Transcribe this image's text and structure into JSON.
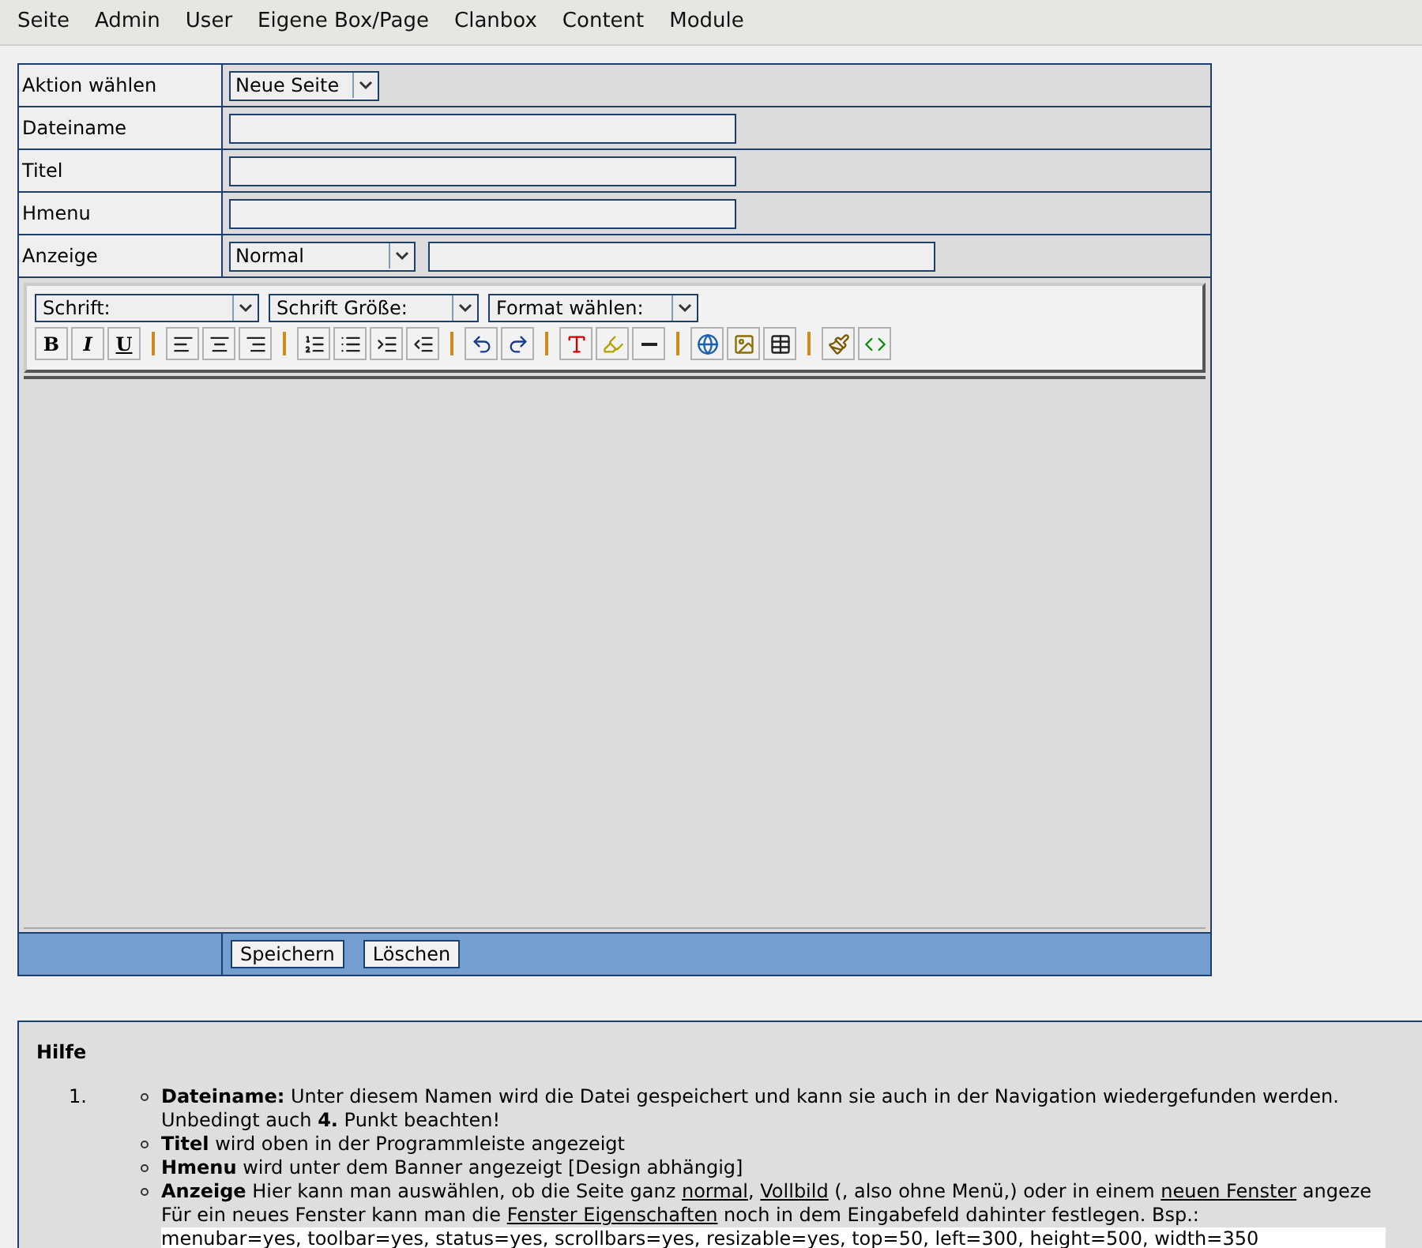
{
  "menu": [
    "Seite",
    "Admin",
    "User",
    "Eigene Box/Page",
    "Clanbox",
    "Content",
    "Module"
  ],
  "form": {
    "rows": [
      {
        "label": "Aktion wählen",
        "kind": "select",
        "value": "Neue Seite"
      },
      {
        "label": "Dateiname",
        "kind": "input"
      },
      {
        "label": "Titel",
        "kind": "input"
      },
      {
        "label": "Hmenu",
        "kind": "input"
      },
      {
        "label": "Anzeige",
        "kind": "select-input",
        "value": "Normal"
      }
    ],
    "editor": {
      "selects": [
        "Schrift:",
        "Schrift Größe:",
        "Format wählen:"
      ],
      "tools": [
        {
          "kind": "bold",
          "label": "B"
        },
        {
          "kind": "italic",
          "label": "I"
        },
        {
          "kind": "underline",
          "label": "U"
        },
        {
          "kind": "separator"
        },
        {
          "kind": "align-left"
        },
        {
          "kind": "align-center"
        },
        {
          "kind": "align-right"
        },
        {
          "kind": "separator"
        },
        {
          "kind": "ordered-list"
        },
        {
          "kind": "bullet-list"
        },
        {
          "kind": "indent"
        },
        {
          "kind": "outdent"
        },
        {
          "kind": "separator"
        },
        {
          "kind": "undo"
        },
        {
          "kind": "redo"
        },
        {
          "kind": "separator"
        },
        {
          "kind": "text-color"
        },
        {
          "kind": "highlight"
        },
        {
          "kind": "rule"
        },
        {
          "kind": "separator"
        },
        {
          "kind": "link"
        },
        {
          "kind": "image"
        },
        {
          "kind": "table"
        },
        {
          "kind": "separator"
        },
        {
          "kind": "clean"
        },
        {
          "kind": "source"
        }
      ]
    },
    "buttons": [
      "Speichern",
      "Löschen"
    ]
  },
  "help": {
    "title": "Hilfe",
    "number": "1.",
    "items": [
      {
        "parts": [
          {
            "kind": "bold",
            "text": "Dateiname:"
          },
          {
            "kind": "text",
            "text": " Unter diesem Namen wird die Datei gespeichert und kann sie auch in der Navigation wiedergefunden werden."
          },
          {
            "kind": "break"
          },
          {
            "kind": "text",
            "text": "Unbedingt auch "
          },
          {
            "kind": "bold",
            "text": "4."
          },
          {
            "kind": "text",
            "text": " Punkt beachten!"
          }
        ]
      },
      {
        "parts": [
          {
            "kind": "bold",
            "text": "Titel"
          },
          {
            "kind": "text",
            "text": " wird oben in der Programmleiste angezeigt"
          }
        ]
      },
      {
        "parts": [
          {
            "kind": "bold",
            "text": "Hmenu"
          },
          {
            "kind": "text",
            "text": " wird unter dem Banner angezeigt [Design abhängig]"
          }
        ]
      },
      {
        "parts": [
          {
            "kind": "bold",
            "text": "Anzeige"
          },
          {
            "kind": "text",
            "text": " Hier kann man auswählen, ob die Seite ganz "
          },
          {
            "kind": "link",
            "text": "normal"
          },
          {
            "kind": "text",
            "text": ", "
          },
          {
            "kind": "link",
            "text": "Vollbild"
          },
          {
            "kind": "text",
            "text": " (, also ohne Menü,) oder in einem "
          },
          {
            "kind": "link",
            "text": "neuen Fenster"
          },
          {
            "kind": "text",
            "text": " angeze"
          },
          {
            "kind": "break"
          },
          {
            "kind": "text",
            "text": "Für ein neues Fenster kann man die "
          },
          {
            "kind": "link",
            "text": "Fenster Eigenschaften"
          },
          {
            "kind": "text",
            "text": " noch in dem Eingabefeld dahinter festlegen. Bsp.:"
          }
        ],
        "example": "menubar=yes, toolbar=yes, status=yes, scrollbars=yes, resizable=yes, top=50, left=300, height=500, width=350"
      }
    ]
  }
}
